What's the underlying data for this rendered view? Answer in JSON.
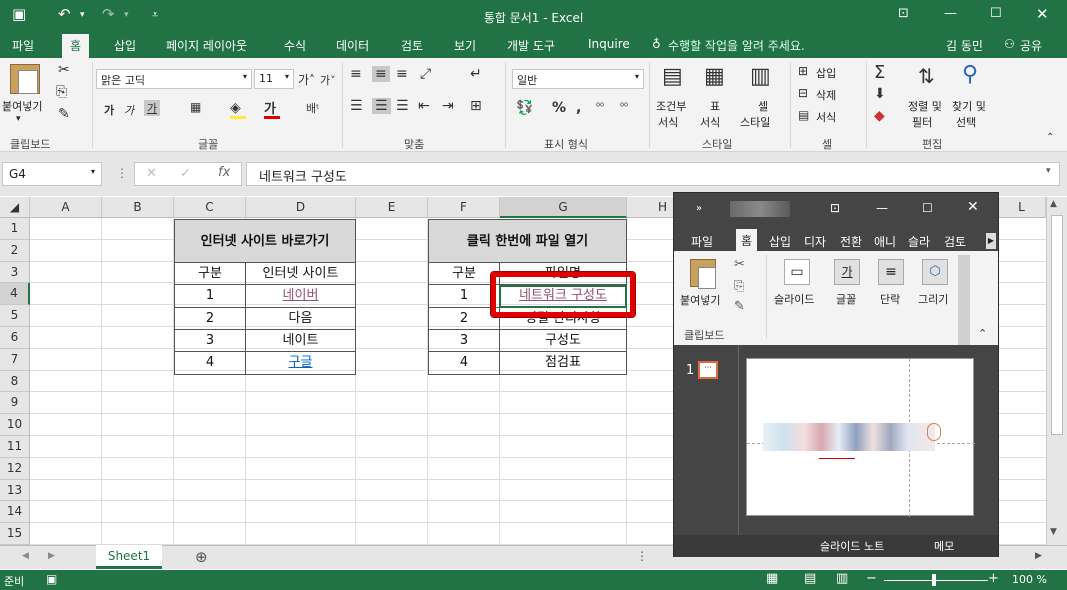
{
  "window": {
    "title": "통합 문서1 - Excel"
  },
  "tabs": [
    "파일",
    "홈",
    "삽입",
    "페이지 레이아웃",
    "수식",
    "데이터",
    "검토",
    "보기",
    "개발 도구",
    "Inquire"
  ],
  "tell_me": "수행할 작업을 알려 주세요.",
  "user": "김 동민",
  "share": "공유",
  "ribbon": {
    "paste": "붙여넣기",
    "font_name": "맑은 고딕",
    "font_size": "11",
    "number_format": "일반",
    "cond_format_l1": "조건부",
    "cond_format_l2": "서식",
    "table_format_l1": "표",
    "table_format_l2": "서식",
    "cell_style_l1": "셀",
    "cell_style_l2": "스타일",
    "insert": "삽입",
    "delete": "삭제",
    "format": "서식",
    "sort_l1": "정렬 및",
    "sort_l2": "필터",
    "find_l1": "찾기 및",
    "find_l2": "선택",
    "groups": {
      "clipboard": "클립보드",
      "font": "글꼴",
      "align": "맞춤",
      "number": "표시 형식",
      "style": "스타일",
      "cells": "셀",
      "edit": "편집"
    }
  },
  "formula": {
    "name_box": "G4",
    "content": "네트워크 구성도"
  },
  "columns": [
    "A",
    "B",
    "C",
    "D",
    "E",
    "F",
    "G",
    "H",
    "L"
  ],
  "rows": [
    "1",
    "2",
    "3",
    "4",
    "5",
    "6",
    "7",
    "8",
    "9",
    "10",
    "11",
    "12",
    "13",
    "14",
    "15"
  ],
  "table1": {
    "title": "인터넷 사이트 바로가기",
    "h1": "구분",
    "h2": "인터넷 사이트",
    "rows": [
      {
        "n": "1",
        "v": "네이버"
      },
      {
        "n": "2",
        "v": "다음"
      },
      {
        "n": "3",
        "v": "네이트"
      },
      {
        "n": "4",
        "v": "구글"
      }
    ]
  },
  "table2": {
    "title": "클릭 한번에 파일 열기",
    "h1": "구분",
    "h2": "파일명",
    "rows": [
      {
        "n": "1",
        "v": "네트워크 구성도"
      },
      {
        "n": "2",
        "v": "정밀 관리사항"
      },
      {
        "n": "3",
        "v": "구성도"
      },
      {
        "n": "4",
        "v": "점검표"
      }
    ]
  },
  "sheet_tab": "Sheet1",
  "status": {
    "ready": "준비",
    "zoom": "100 %"
  },
  "ppt": {
    "tabs": [
      "파일",
      "홈",
      "삽입",
      "디자",
      "전환",
      "애니",
      "슬라",
      "검토"
    ],
    "paste": "붙여넣기",
    "slide": "슬라이드",
    "font": "글꼴",
    "para": "단락",
    "draw": "그리기",
    "clipboard": "클립보드",
    "slide_num": "1",
    "notes": "슬라이드 노트",
    "memo": "메모"
  },
  "colors": {
    "excel_green": "#217346",
    "highlight": "#e00000"
  }
}
